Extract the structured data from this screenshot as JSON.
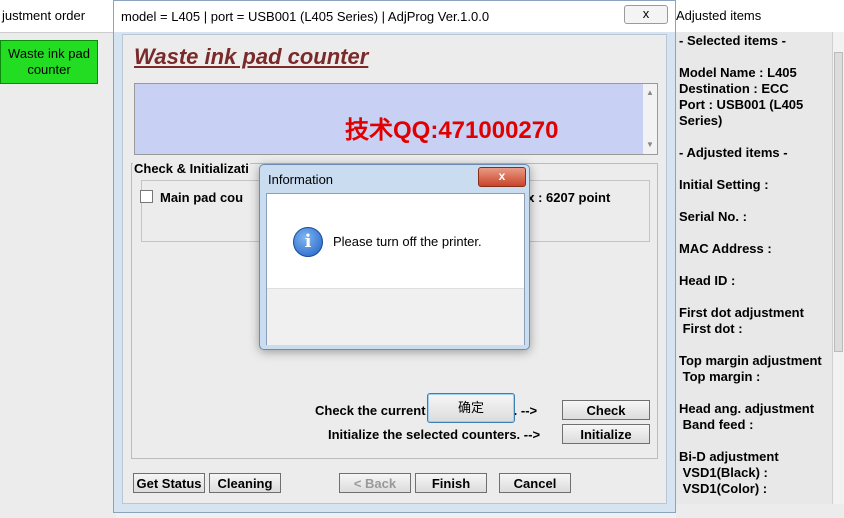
{
  "left_window": {
    "title": "justment order",
    "waste_button": "Waste ink pad counter"
  },
  "right_window": {
    "title": "Adjusted items",
    "items": [
      "- Selected items -",
      "Model Name : L405",
      "Destination : ECC",
      "Port : USB001 (L405",
      "Series)",
      "- Adjusted items -",
      "Initial Setting :",
      "Serial No. :",
      "MAC Address :",
      "Head ID :",
      "First dot adjustment",
      " First dot :",
      "Top margin adjustment",
      " Top margin :",
      "Head ang. adjustment",
      " Band feed :",
      "Bi-D adjustment",
      " VSD1(Black) :",
      " VSD1(Color) :"
    ]
  },
  "main_window": {
    "title": "model = L405 | port = USB001 (L405 Series) | AdjProg Ver.1.0.0",
    "close_label": "x",
    "heading": "Waste ink pad counter",
    "message": "技术QQ:471000270",
    "group_label": "Check & Initializati",
    "main_pad_label": "Main pad cou",
    "main_pad_max": "ax : 6207 point",
    "check_hint": "Check the current counter value. -->",
    "init_hint": "Initialize the selected counters. -->",
    "check_button": "Check",
    "initialize_button": "Initialize",
    "get_status_button": "Get Status",
    "cleaning_button": "Cleaning",
    "back_button": "< Back",
    "finish_button": "Finish",
    "cancel_button": "Cancel"
  },
  "dialog": {
    "title": "Information",
    "close_label": "x",
    "message": "Please turn off the printer.",
    "ok_button": "确定",
    "icon": "info-icon"
  },
  "colors": {
    "waste_button_bg": "#22dd22",
    "heading_color": "#7a2a2a",
    "message_color": "#e00000",
    "message_box_bg": "#c8d0f4"
  }
}
